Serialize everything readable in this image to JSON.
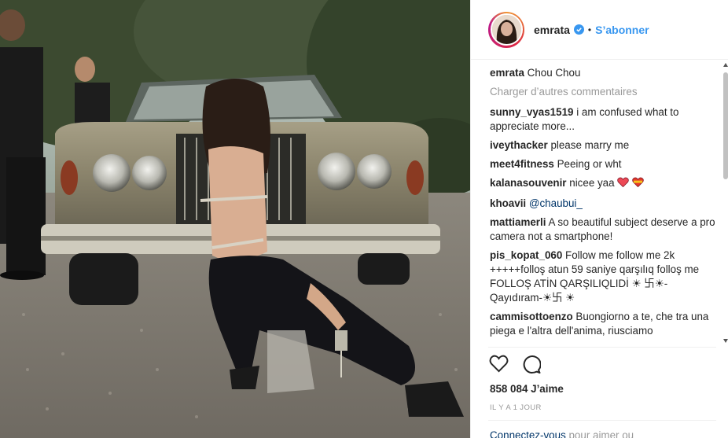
{
  "post": {
    "username": "emrata",
    "follow_label": "S’abonner",
    "separator": "•"
  },
  "caption": {
    "username": "emrata",
    "text": "Chou Chou"
  },
  "load_more_label": "Charger d’autres commentaires",
  "comments": [
    {
      "user": "sunny_vyas1519",
      "text": "i am confused what to appreciate more..."
    },
    {
      "user": "iveythacker",
      "text": "please marry me"
    },
    {
      "user": "meet4fitness",
      "text": "Peeing or wht"
    },
    {
      "user": "kalanasouvenir",
      "text": "nicee yaa"
    },
    {
      "user": "khoavii",
      "text": "@chaubui_"
    },
    {
      "user": "mattiamerli",
      "text": "A so beautiful subject deserve a pro camera not a smartphone!"
    },
    {
      "user": "pis_kopat_060",
      "text": "Follow me follow me 2k +++++folloş atun 59 saniye qarşılıq folloş me FOLLOŞ ATİN QARŞILIQLIDİ ☀ 卐☀-Qayıdıram-☀卐 ☀"
    },
    {
      "user": "cammisottoenzo",
      "text": "Buongiorno a te, che tra una piega e l'altra dell'anima, riusciamo"
    }
  ],
  "icons": {
    "like": "heart-outline-icon",
    "comment": "comment-bubble-icon",
    "verified": "verified-badge-icon"
  },
  "colors": {
    "link_blue": "#3897f0",
    "text": "#262626",
    "muted": "#999999",
    "heart_red": "#ed4956"
  },
  "likes_text": "858 084 J’aime",
  "timestamp": "IL Y A 1 JOUR",
  "login_prompt": {
    "link": "Connectez-vous",
    "rest": " pour aimer ou"
  }
}
